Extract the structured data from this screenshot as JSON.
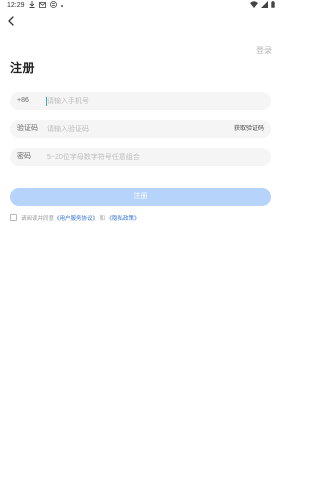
{
  "status_bar": {
    "time": "12:29",
    "left_icons": [
      "download-icon",
      "mail-icon",
      "app-icon",
      "dot-icon"
    ],
    "right_icons": [
      "wifi-icon",
      "signal-icon",
      "battery-icon"
    ]
  },
  "header": {
    "back_icon": "chevron-left-icon",
    "login_label": "登录"
  },
  "page": {
    "title": "注册"
  },
  "form": {
    "phone": {
      "prefix": "+86",
      "placeholder": "请输入手机号",
      "value": ""
    },
    "code": {
      "label": "验证码",
      "placeholder": "请输入验证码",
      "value": "",
      "button_label": "获取验证码"
    },
    "password": {
      "label": "密码",
      "placeholder": "5~20位字母数字符号任意组合",
      "value": ""
    },
    "submit_label": "注册"
  },
  "agreement": {
    "prefix": "请阅读并同意",
    "user_agreement": "《用户服务协议》",
    "conjunction": "和",
    "privacy_policy": "《隐私政策》",
    "checked": false
  },
  "colors": {
    "accent_link": "#2f6fd6",
    "button_disabled": "#b6d3fb",
    "field_background": "#f5f5f5",
    "caret": "#3aa9c9"
  }
}
